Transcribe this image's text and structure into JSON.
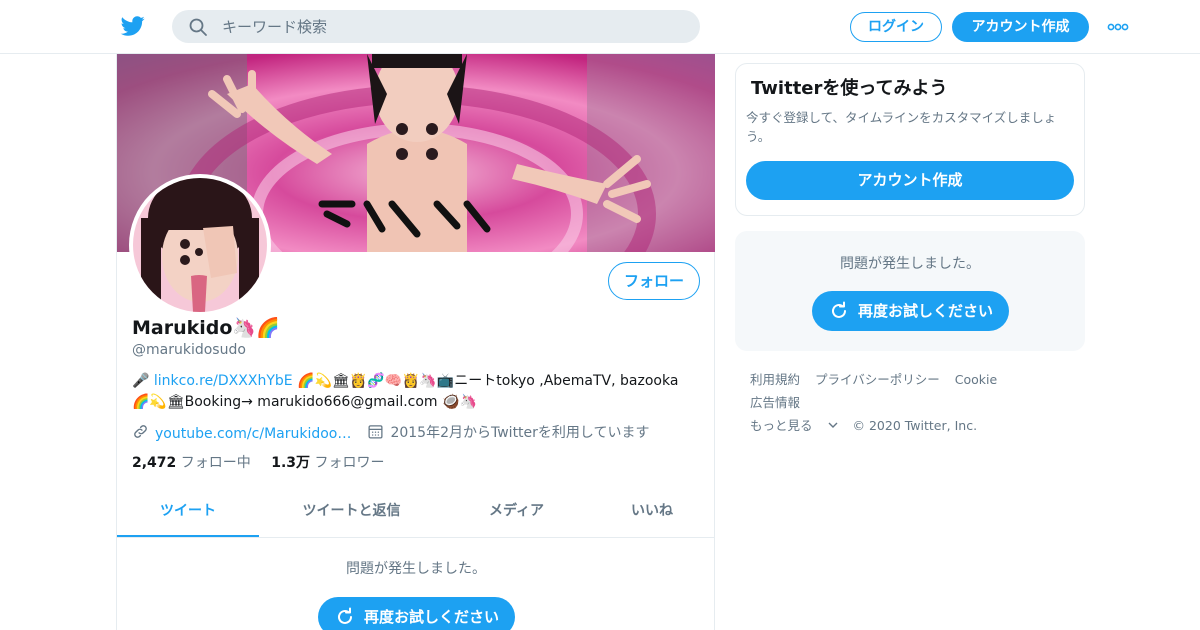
{
  "header": {
    "search_placeholder": "キーワード検索",
    "login_label": "ログイン",
    "signup_label": "アカウント作成"
  },
  "profile": {
    "follow_label": "フォロー",
    "name": "Marukido🦄🌈",
    "handle": "@marukidosudo",
    "bio_link": "linkco.re/DXXXhYbE",
    "bio_rest_1": "🌈💫🏛👸🧬🧠👸🦄📺ニートtokyo ,AbemaTV, bazooka",
    "bio_line_2": "🌈💫🏛Booking→ marukido666@gmail.com 🥥🦄",
    "website": "youtube.com/c/Marukidoofficial",
    "joined": "2015年2月からTwitterを利用しています",
    "following_count": "2,472",
    "following_label": "フォロー中",
    "followers_count": "1.3万",
    "followers_label": "フォロワー"
  },
  "tabs": [
    {
      "label": "ツイート",
      "active": true
    },
    {
      "label": "ツイートと返信",
      "active": false
    },
    {
      "label": "メディア",
      "active": false
    },
    {
      "label": "いいね",
      "active": false
    }
  ],
  "timeline": {
    "error_text": "問題が発生しました。",
    "retry_label": "再度お試しください"
  },
  "sidebar": {
    "signup_card": {
      "title": "Twitterを使ってみよう",
      "description": "今すぐ登録して、タイムラインをカスタマイズしましょう。",
      "cta": "アカウント作成"
    },
    "error_card": {
      "error_text": "問題が発生しました。",
      "retry_label": "再度お試しください"
    },
    "footer": {
      "terms": "利用規約",
      "privacy": "プライバシーポリシー",
      "cookie": "Cookie",
      "ads": "広告情報",
      "more": "もっと見る",
      "copyright": "© 2020 Twitter, Inc."
    }
  },
  "colors": {
    "brand": "#1da1f2",
    "text_primary": "#14171a",
    "text_secondary": "#657786",
    "border": "#e6ecf0"
  },
  "icons": [
    "twitter-logo-icon",
    "search-icon",
    "more-dots-icon",
    "link-icon",
    "calendar-icon",
    "refresh-icon",
    "chevron-down-icon"
  ]
}
